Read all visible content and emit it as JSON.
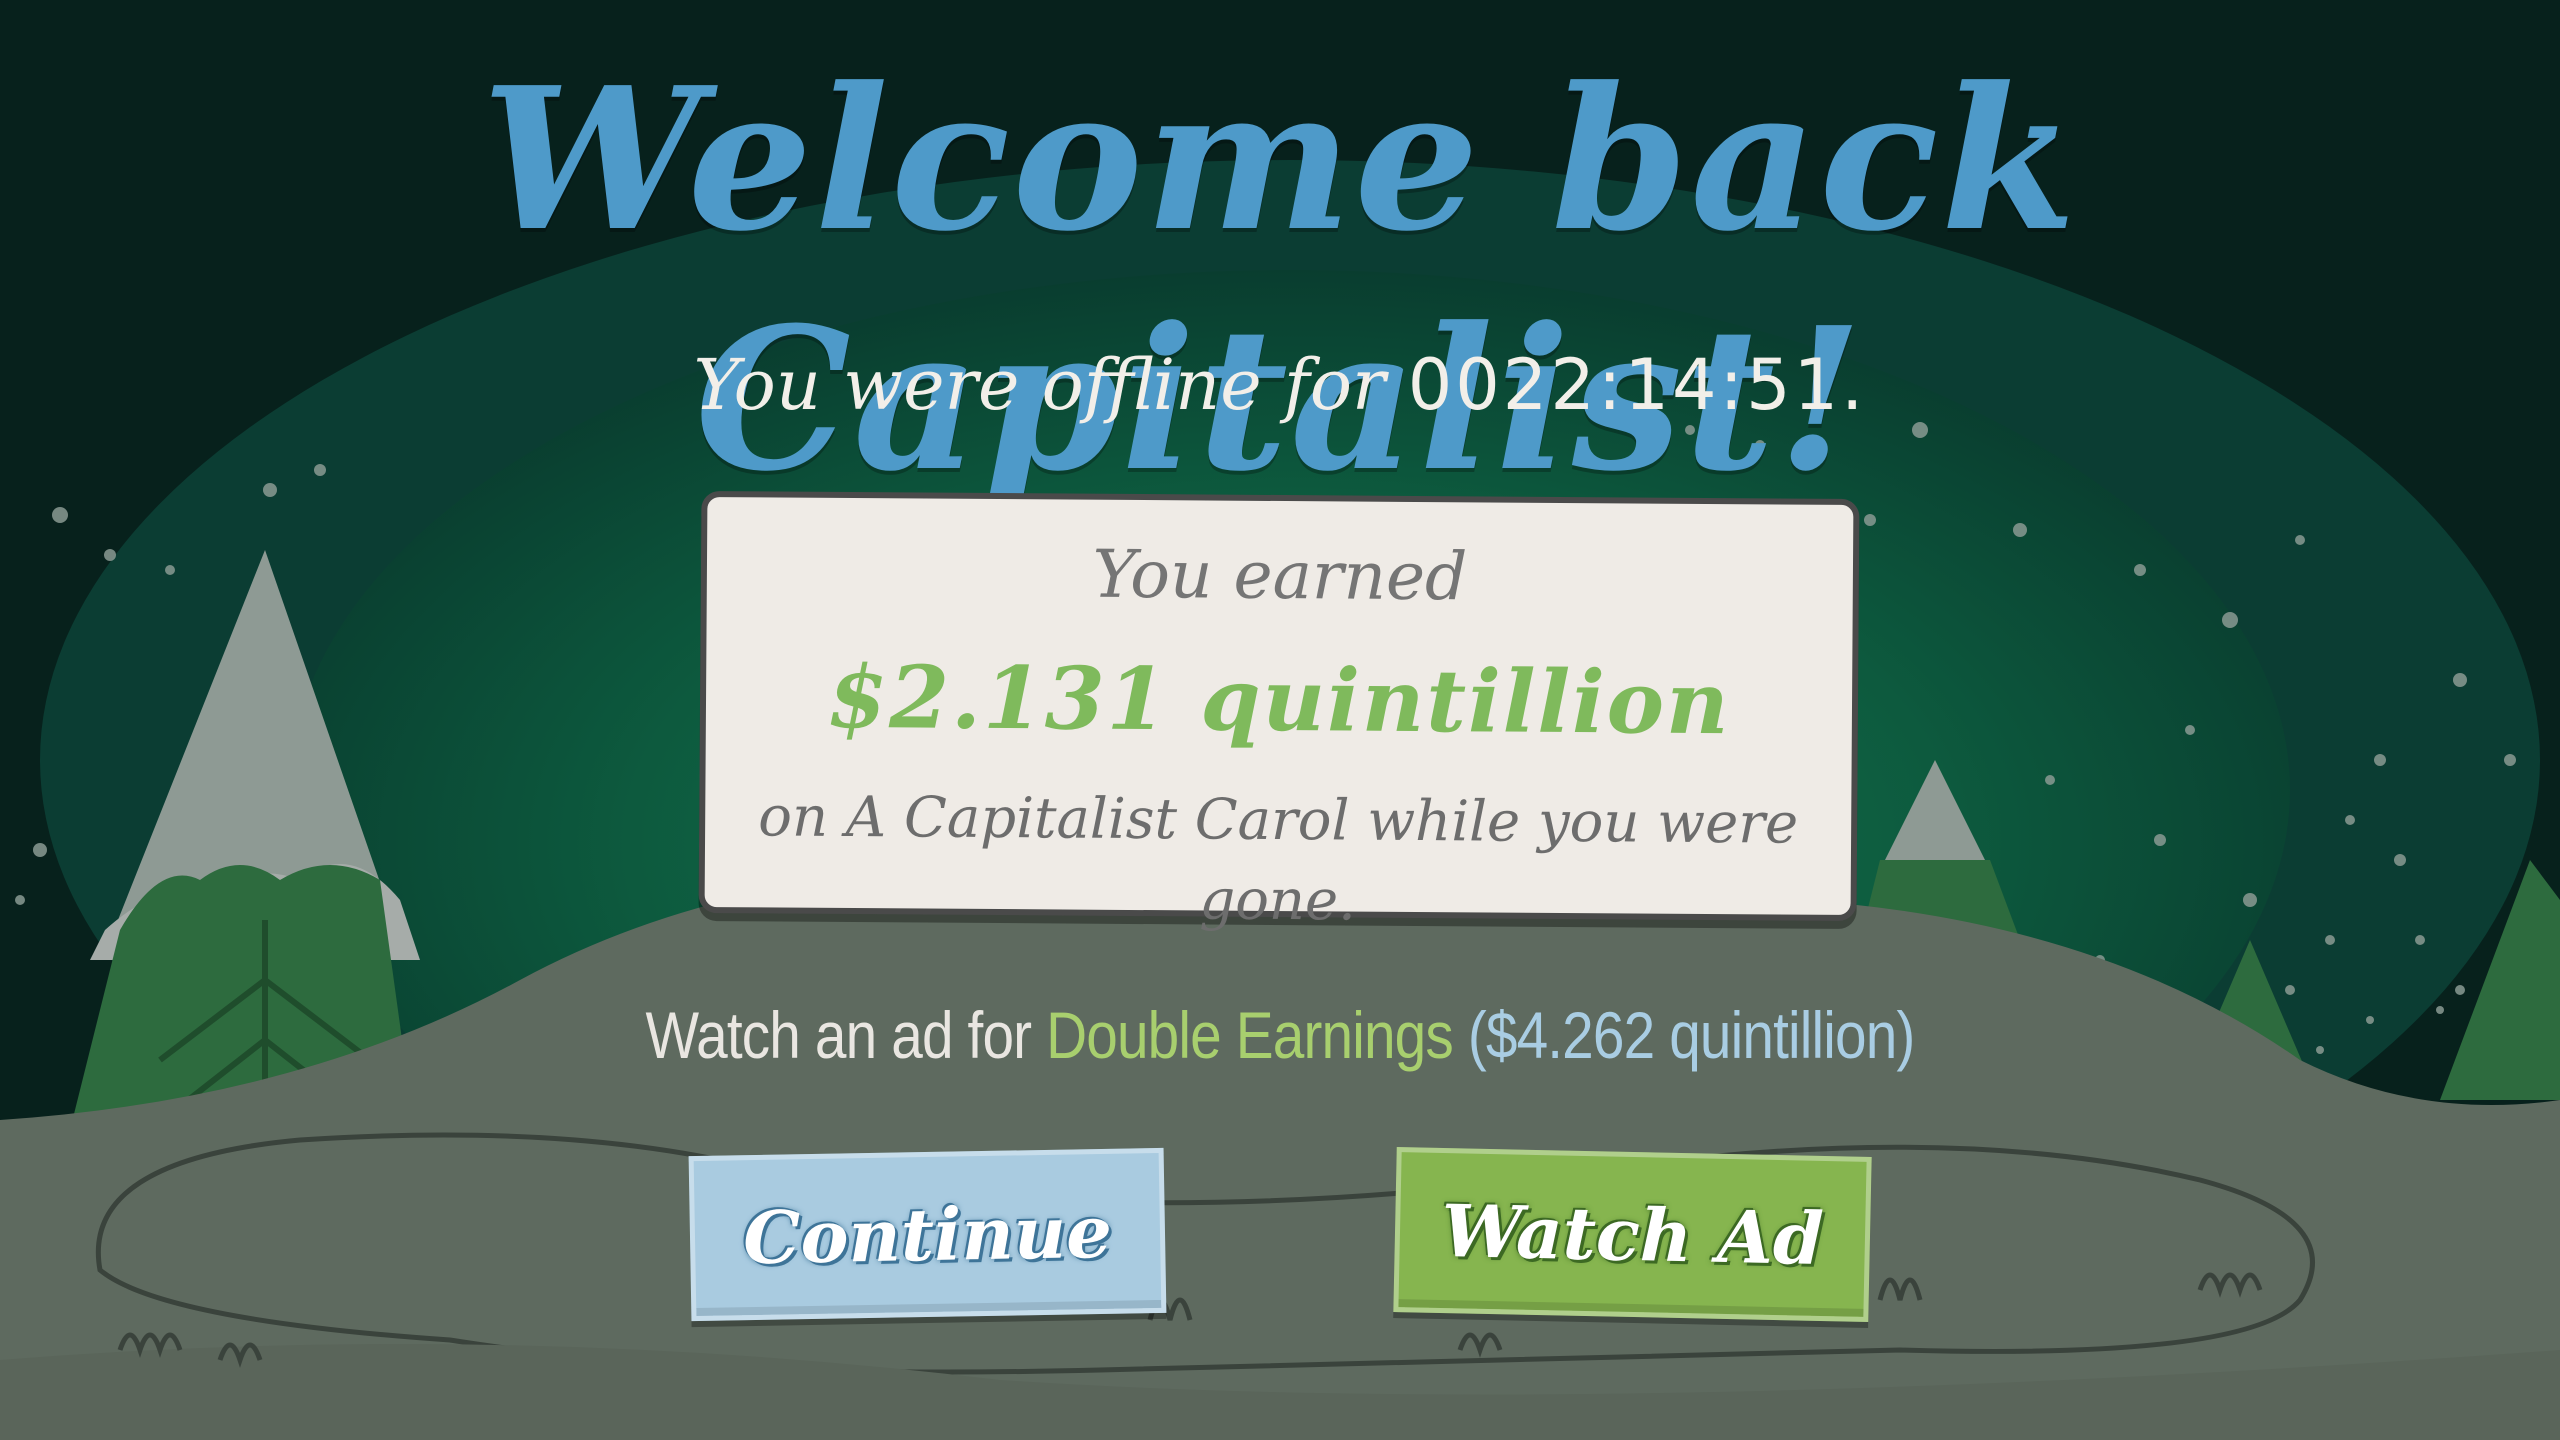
{
  "title": "Welcome back Capitalist!",
  "offline": {
    "prefix": "You were offline for",
    "time": "0022:14:51."
  },
  "earnings_card": {
    "label": "You earned",
    "amount": "$2.131 quintillion",
    "detail": "on A Capitalist Carol while you were gone."
  },
  "ad_offer": {
    "prefix": "Watch an ad for",
    "bonus_name": "Double Earnings",
    "bonus_value": "($4.262 quintillion)"
  },
  "buttons": {
    "continue_label": "Continue",
    "watch_ad_label": "Watch Ad"
  },
  "colors": {
    "title": "#4e9ac9",
    "amount": "#7fba5c",
    "continue_button": "#a9cbe0",
    "watch_ad_button": "#86b54f",
    "night_sky": "#07211c",
    "aurora": "#0e5a3f",
    "hill": "#5e6a5f"
  }
}
